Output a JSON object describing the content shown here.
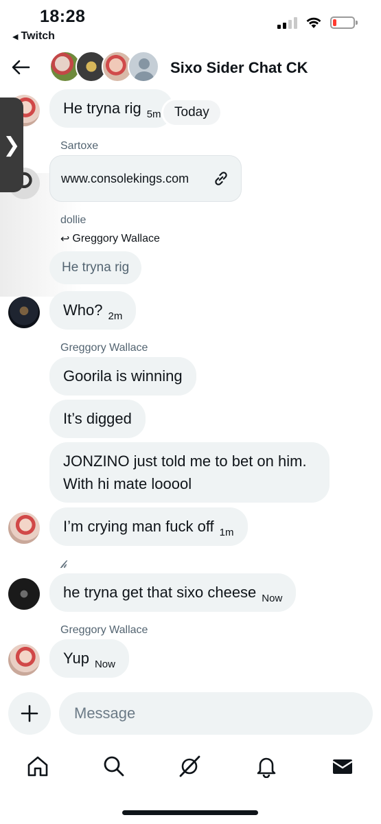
{
  "status_bar": {
    "time": "18:28",
    "back_app": "Twitch"
  },
  "header": {
    "title": "Sixo Sider Chat CK"
  },
  "messages": {
    "m1": {
      "text": "He tryna rig",
      "time": "5m"
    },
    "date_chip": "Today",
    "sartoxe_name": "Sartoxe",
    "link": "www.consolekings.com",
    "dollie_name": "dollie",
    "reply_to": "Greggory Wallace",
    "quoted_text": "He tryna rig",
    "m2": {
      "text": "Who?",
      "time": "2m"
    },
    "gw_name_1": "Greggory Wallace",
    "m3": {
      "text": "Goorila is winning"
    },
    "m4": {
      "text": "It’s digged"
    },
    "m5": {
      "text": "JONZINO just told me to bet on him. With hi mate looool"
    },
    "m6": {
      "text": "I’m crying man fuck off",
      "time": "1m"
    },
    "h_name": "𝒽",
    "m7": {
      "text": "he tryna get that sixo cheese",
      "time": "Now"
    },
    "gw_name_2": "Greggory Wallace",
    "m8": {
      "text": "Yup",
      "time": "Now"
    }
  },
  "composer": {
    "placeholder": "Message"
  },
  "nav": [
    "home-icon",
    "search-icon",
    "grok-icon",
    "notifications-icon",
    "messages-icon"
  ]
}
